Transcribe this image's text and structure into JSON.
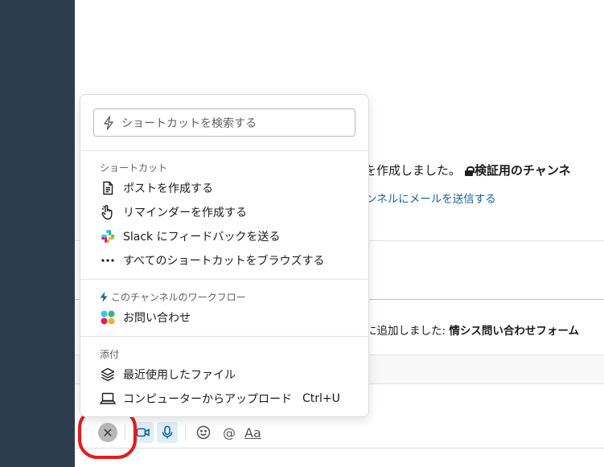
{
  "channel_message": {
    "line1_prefix": "ルを作成しました。",
    "line1_channel": "検証用のチャンネ",
    "link_text": "ンネルにメールを送信する",
    "line2_prefix": "に追加しました: ",
    "line2_bold": "情シス問い合わせフォーム"
  },
  "shortcut_popup": {
    "search_placeholder": "ショートカットを検索する",
    "sections": {
      "shortcuts": {
        "title": "ショートカット",
        "items": [
          {
            "label": "ポストを作成する",
            "icon": "document-icon"
          },
          {
            "label": "リマインダーを作成する",
            "icon": "hand-pointer-icon"
          },
          {
            "label": "Slack にフィードバックを送る",
            "icon": "slack-logo-icon"
          },
          {
            "label": "すべてのショートカットをブラウズする",
            "icon": "more-dots-icon"
          }
        ]
      },
      "workflows": {
        "title": "このチャンネルのワークフロー",
        "items": [
          {
            "label": "お問い合わせ",
            "icon": "workflow-icon"
          }
        ]
      },
      "attachments": {
        "title": "添付",
        "items": [
          {
            "label": "最近使用したファイル",
            "icon": "layers-icon"
          },
          {
            "label": "コンピューターからアップロード",
            "icon": "laptop-icon",
            "shortcut": "Ctrl+U"
          }
        ]
      }
    }
  },
  "composer_toolbar": {
    "close_icon": "close-icon",
    "video_icon": "video-icon",
    "mic_icon": "microphone-icon",
    "emoji_icon": "emoji-icon",
    "mention_label": "@",
    "format_label": "Aa"
  },
  "colors": {
    "sidebar": "#2d3d4e",
    "link": "#1264a3",
    "annotation": "#e8191d",
    "new_message_line": "#e8aab6"
  }
}
